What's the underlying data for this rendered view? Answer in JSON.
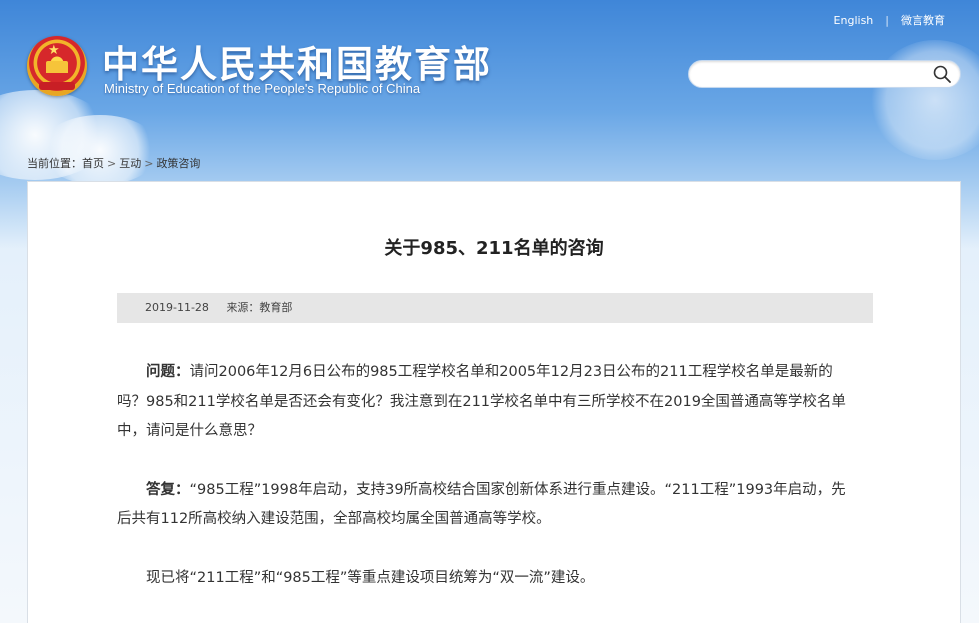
{
  "header": {
    "title": "中华人民共和国教育部",
    "subtitle": "Ministry of Education of the People's Republic of China",
    "links": {
      "english": "English",
      "weibo": "微言教育"
    },
    "search": {
      "value": "",
      "placeholder": ""
    }
  },
  "breadcrumb": {
    "prefix": "当前位置：",
    "items": [
      "首页",
      "互动",
      "政策咨询"
    ]
  },
  "article": {
    "title": "关于985、211名单的咨询",
    "date": "2019-11-28",
    "source": "来源：教育部",
    "paragraphs": [
      {
        "lead": "问题：",
        "text": "请问2006年12月6日公布的985工程学校名单和2005年12月23日公布的211工程学校名单是最新的吗？985和211学校名单是否还会有变化？我注意到在211学校名单中有三所学校不在2019全国普通高等学校名单中，请问是什么意思？"
      },
      {
        "lead": "答复：",
        "text": "“985工程”1998年启动，支持39所高校结合国家创新体系进行重点建设。“211工程”1993年启动，先后共有112所高校纳入建设范围，全部高校均属全国普通高等学校。"
      },
      {
        "lead": "",
        "text": "现已将“211工程”和“985工程”等重点建设项目统筹为“双一流”建设。"
      }
    ]
  },
  "colors": {
    "header_blue": "#3f86d8",
    "panel_bg": "#ffffff",
    "meta_bar": "#e6e6e6"
  }
}
